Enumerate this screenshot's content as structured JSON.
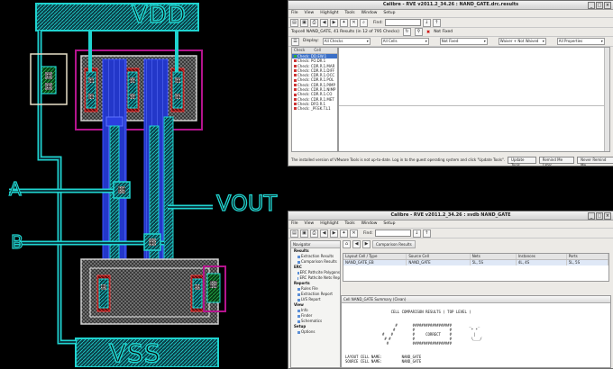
{
  "layout_labels": {
    "vdd": "VDD",
    "vss": "VSS",
    "a": "A",
    "b": "B",
    "vout": "VOUT"
  },
  "drc_window": {
    "title": "Calibre - RVE v2011.2_34.26 : NAND_GATE.drc.results",
    "menu": [
      "File",
      "View",
      "Highlight",
      "Tools",
      "Window",
      "Setup"
    ],
    "find_label": "Find:",
    "info_text": "Topcell NAND_GATE, 41 Results (in 12 of 795 Checks)",
    "not_fixed": "Not Fixed",
    "display_label": "Display:",
    "filters": [
      "All Checks",
      "All Cells",
      "Not Fixed",
      "Waiver + Not Waived",
      "All Properties"
    ],
    "list_headers": [
      "Check",
      "Cell"
    ],
    "checks": [
      "Check: DD.EW.1",
      "Check: PO.DR.1",
      "Check: CDR.R.1.MAR",
      "Check: CDR.R.1.DIFF",
      "Check: CDR.R.1.OCC",
      "Check: CDR.R.1.POL",
      "Check: CDR.R.1.PIMP",
      "Check: CDR.R.1.NIMP",
      "Check: CDR.R.1.CO",
      "Check: CDR.R.1.MET",
      "Check: DFO.R.1",
      "Check: _PF.EK.T.L1"
    ],
    "status_text": "The installed version of VMware Tools is not up-to-date. Log in to the guest operating system and click \"Update Tools\".",
    "status_buttons": [
      "Update Tools",
      "Remind Me Later",
      "Never Remind Me"
    ]
  },
  "lvs_window": {
    "title": "Calibre - RVE v2011.2_34.26 : svdb NAND_GATE",
    "menu": [
      "File",
      "View",
      "Highlight",
      "Tools",
      "Window",
      "Setup"
    ],
    "find_label": "Find:",
    "nav_tab": "Navigator",
    "compare_tab": "Comparison Results",
    "nav_sections": [
      {
        "label": "Results",
        "items": [
          "Extraction Results",
          "Comparison Results"
        ]
      },
      {
        "label": "ERC",
        "items": [
          "ERC Pathcite Polygons",
          "ERC Pathcite Nets Rep"
        ]
      },
      {
        "label": "Reports",
        "items": [
          "Rules File",
          "Extraction Report",
          "LVS Report"
        ]
      },
      {
        "label": "View",
        "items": [
          "Info",
          "Finder",
          "Schematics"
        ]
      },
      {
        "label": "Setup",
        "items": [
          "Options"
        ]
      }
    ],
    "table_headers": [
      "Layout Cell / Type",
      "Source Cell",
      "Nets",
      "Instances",
      "Ports"
    ],
    "table_row": [
      "NAND_GATE_EB",
      "NAND_GATE",
      "5L, 5S",
      "4L, 4S",
      "5L, 5S"
    ],
    "summary_title": "Cell NAND_GATE Summary (Clean)",
    "summary_lines": [
      "                     CELL COMPARISON RESULTS ( TOP LEVEL )",
      "",
      "",
      "                       #       ##################        _   _",
      "                      #        #                #         * *",
      "                 #   #         #     CORRECT    #          |",
      "                  # #          #                #         \\___/",
      "                   #           ##################",
      "",
      "",
      "LAYOUT CELL NAME:         NAND_GATE",
      "SOURCE CELL NAME:         NAND_GATE"
    ]
  },
  "colors": {
    "background": "#000000",
    "cyan": "#1fd3cf",
    "blue": "#2b3fe0",
    "magenta": "#b4148d",
    "red": "#c01515",
    "green": "#1f9a3a",
    "window_bg": "#eceae6",
    "selection": "#3a6fc7"
  }
}
